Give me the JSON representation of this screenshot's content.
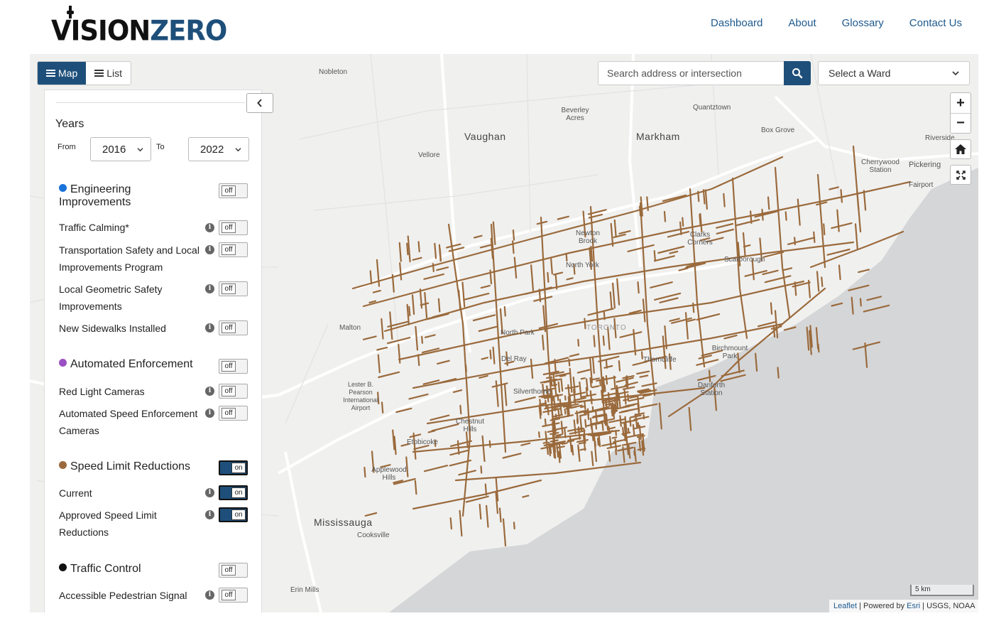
{
  "header": {
    "logo_vision": "VISION",
    "logo_zero": "ZERO",
    "nav": [
      "Dashboard",
      "About",
      "Glossary",
      "Contact Us"
    ]
  },
  "view_toggle": {
    "map_label": "Map",
    "list_label": "List",
    "active": "Map"
  },
  "search": {
    "placeholder": "Search address or intersection"
  },
  "ward_select": {
    "value": "Select a Ward"
  },
  "zoom": {
    "in": "+",
    "out": "−"
  },
  "years": {
    "title": "Years",
    "from_label": "From",
    "to_label": "To",
    "from": "2016",
    "to": "2022"
  },
  "groups": {
    "engineering": {
      "label": "Engineering Improvements",
      "color": "#1a73d9",
      "state": "off"
    },
    "enforcement": {
      "label": "Automated Enforcement",
      "color": "#9b4fc4",
      "state": "off"
    },
    "speed": {
      "label": "Speed Limit Reductions",
      "color": "#9a6a3c",
      "state": "on"
    },
    "traffic": {
      "label": "Traffic Control",
      "color": "#111111",
      "state": "off"
    }
  },
  "items": {
    "traffic_calming": {
      "label": "Traffic Calming*",
      "state": "off"
    },
    "tsli": {
      "label": "Transportation Safety and Local Improvements Program",
      "state": "off"
    },
    "lgsi": {
      "label": "Local Geometric Safety Improvements",
      "state": "off"
    },
    "sidewalks": {
      "label": "New Sidewalks Installed",
      "state": "off"
    },
    "red_light": {
      "label": "Red Light Cameras",
      "state": "off"
    },
    "ase": {
      "label": "Automated Speed Enforcement Cameras",
      "state": "off"
    },
    "current": {
      "label": "Current",
      "state": "on"
    },
    "approved": {
      "label": "Approved Speed Limit Reductions",
      "state": "on"
    },
    "aps": {
      "label": "Accessible Pedestrian Signal",
      "state": "off"
    }
  },
  "map_labels": {
    "nobleton": "Nobleton",
    "vaughan": "Vaughan",
    "markham": "Markham",
    "quantztown": "Quantztown",
    "beverley": "Beverley Acres",
    "boxgrove": "Box Grove",
    "riverside": "Riverside",
    "cherrywood": "Cherrywood Station",
    "pickering": "Pickering",
    "fairport": "Fairport",
    "vellore": "Vellore",
    "newton": "Newton Brook",
    "clarks": "Clarks Corners",
    "northyork": "North York",
    "scarborough": "Scarborough",
    "malton": "Malton",
    "northpark": "North Park",
    "toronto": "TORONTO",
    "birchmount": "Birchmount Park",
    "delray": "Del Ray",
    "thorncliffe": "Thorncliffe",
    "lester": "Lester B. Pearson International Airport",
    "silverthorne": "Silverthorne",
    "danforth": "Danforth Station",
    "chestnut": "Chestnut Hills",
    "etobicoke": "Etobicoke",
    "applewood": "Applewood Hills",
    "mississauga": "Mississauga",
    "cooksville": "Cooksville",
    "erinmills": "Erin Mills"
  },
  "scale": "5 km",
  "attribution": {
    "leaflet": "Leaflet",
    "powered": " | Powered by ",
    "esri": "Esri",
    "sources": " | USGS, NOAA"
  },
  "colors": {
    "brand": "#1e4f7a",
    "speed_lines": "#9a6a3c",
    "water": "#d4d5d7",
    "land": "#f0f0ef"
  }
}
